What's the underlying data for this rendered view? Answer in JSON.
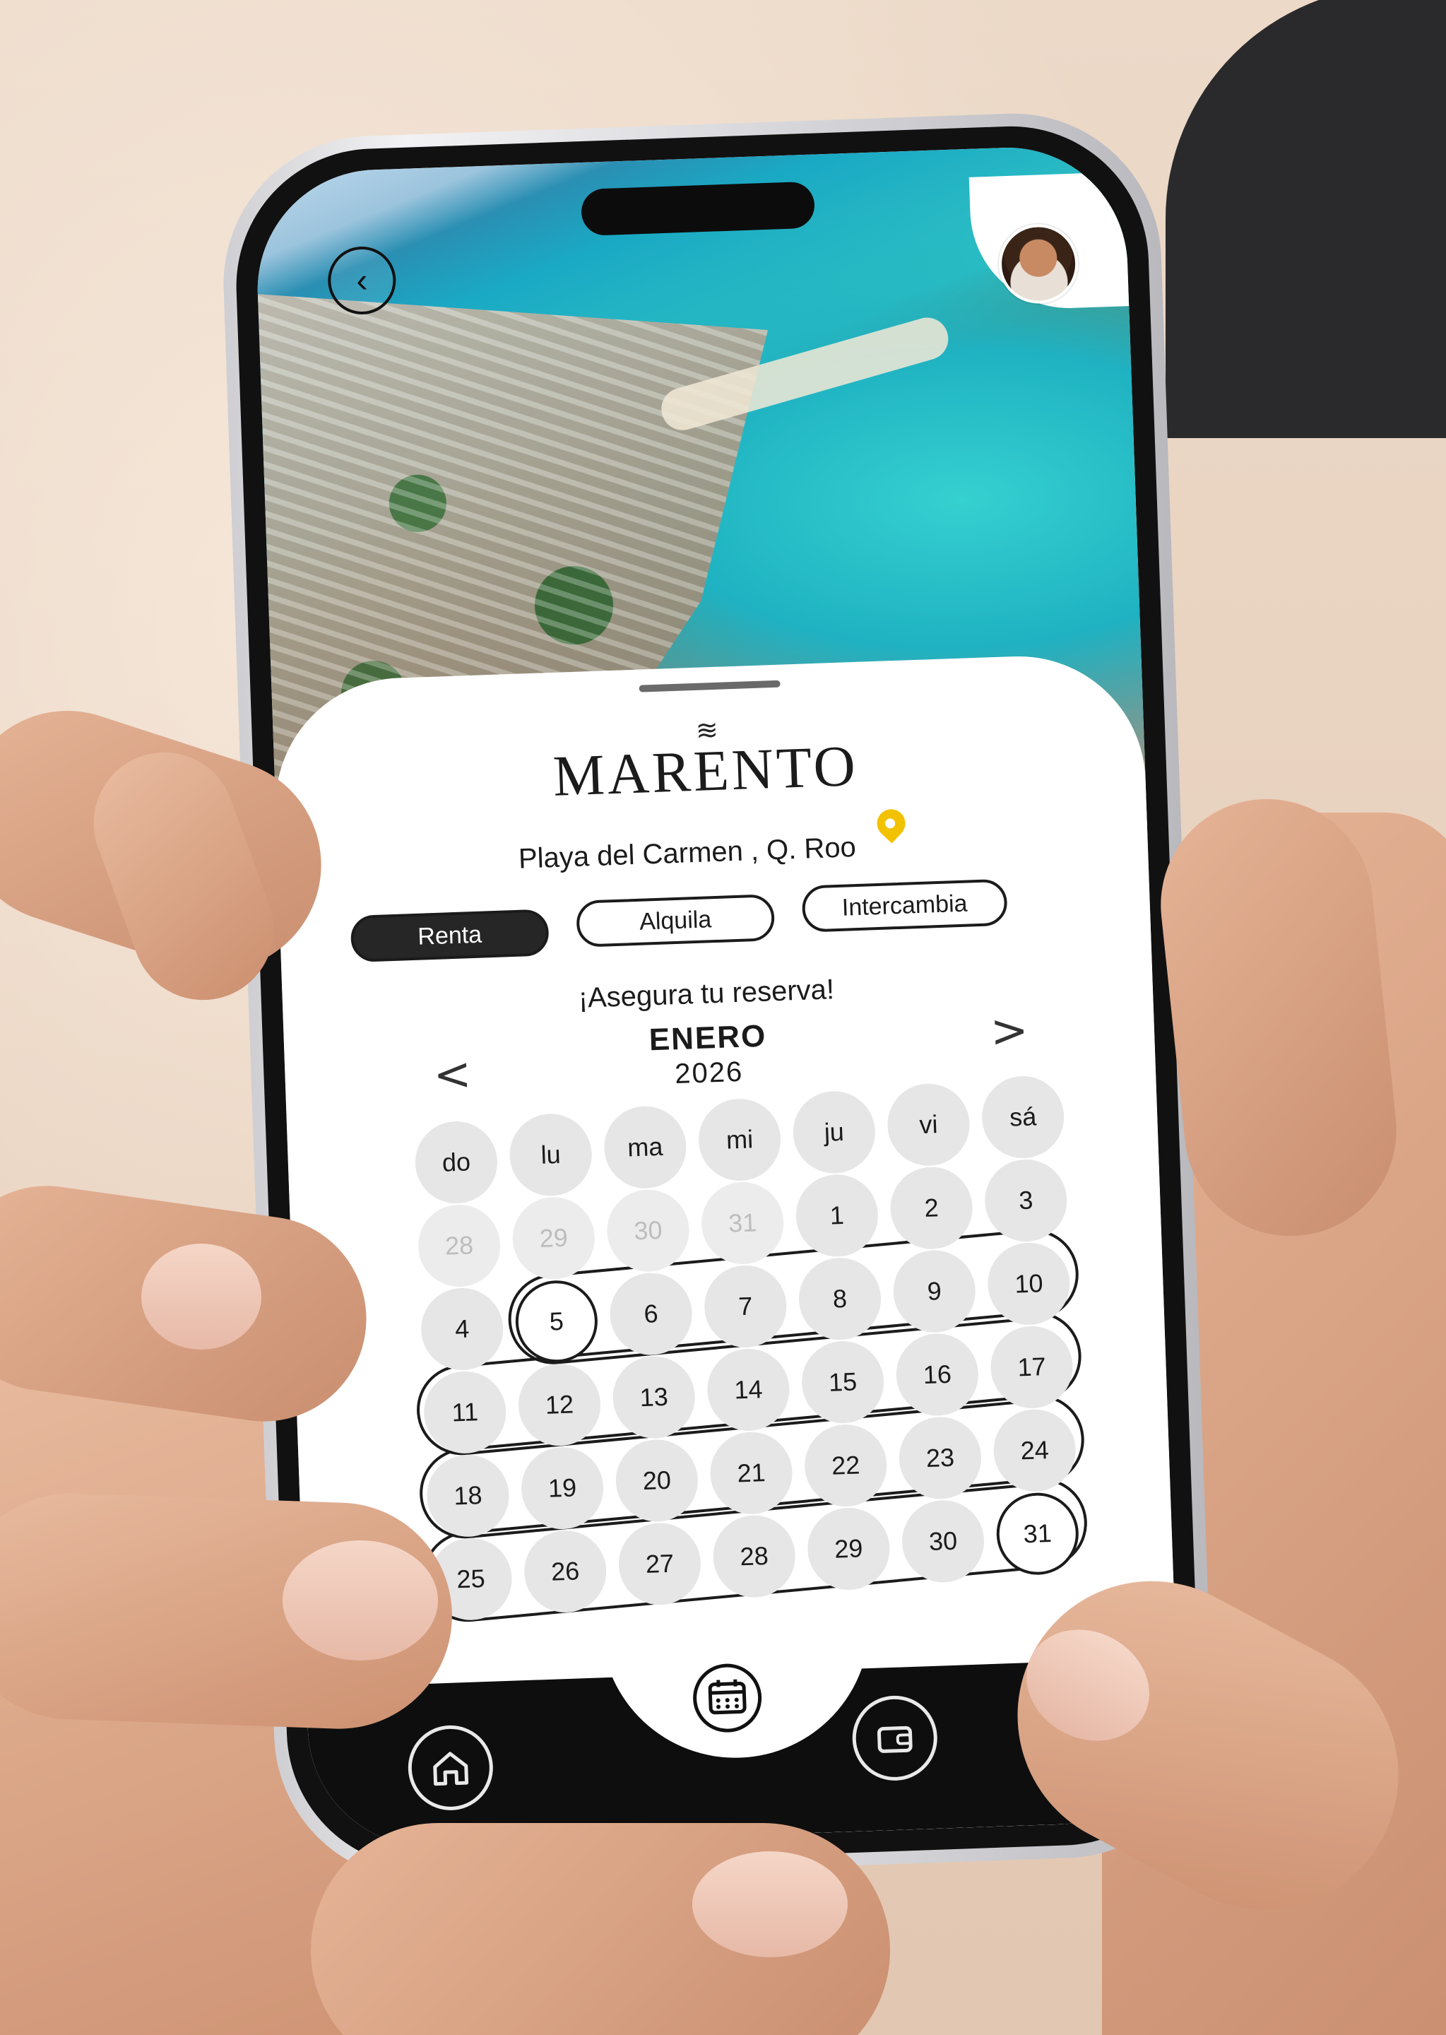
{
  "app": {
    "brand_mark": "≋",
    "brand": "MARENTO",
    "location": "Playa del Carmen , Q. Roo",
    "tabs": [
      {
        "label": "Renta",
        "active": true
      },
      {
        "label": "Alquila",
        "active": false
      },
      {
        "label": "Intercambia",
        "active": false
      }
    ],
    "cta": "¡Asegura tu reserva!",
    "calendar": {
      "month": "ENERO",
      "year": "2026",
      "prev": "<",
      "next": ">",
      "weekdays": [
        "do",
        "lu",
        "ma",
        "mi",
        "ju",
        "vi",
        "sá"
      ],
      "weeks": [
        [
          "28",
          "29",
          "30",
          "31",
          "1",
          "2",
          "3"
        ],
        [
          "4",
          "5",
          "6",
          "7",
          "8",
          "9",
          "10"
        ],
        [
          "11",
          "12",
          "13",
          "14",
          "15",
          "16",
          "17"
        ],
        [
          "18",
          "19",
          "20",
          "21",
          "22",
          "23",
          "24"
        ],
        [
          "25",
          "26",
          "27",
          "28",
          "29",
          "30",
          "31"
        ]
      ],
      "previous_month_days": [
        "28",
        "29",
        "30",
        "31"
      ],
      "selected_start": "5",
      "selected_end": "31"
    },
    "icons": {
      "back": "back-arrow-icon",
      "avatar": "user-avatar",
      "pin": "location-pin-icon",
      "home": "home-icon",
      "calendar": "calendar-icon",
      "wallet": "wallet-icon",
      "mail": "mail-icon"
    },
    "colors": {
      "accent_dark": "#262626",
      "pin_yellow": "#f2c200",
      "day_bg": "#e6e6e6",
      "nav_bg": "#0e0e0e"
    }
  }
}
